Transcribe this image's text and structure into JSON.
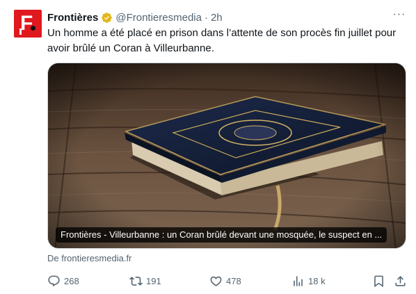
{
  "account": {
    "display_name": "Frontières",
    "handle": "@Frontieresmedia",
    "separator": "·",
    "time": "2h",
    "avatar_letter": "F",
    "avatar_color": "#e0191f",
    "verified_color": "#e2b719"
  },
  "menu": {
    "more_label": "···"
  },
  "tweet": {
    "text": "Un homme a été placé en prison dans l’attente de son procès fin juillet pour avoir brûlé un Coran à Villeurbanne."
  },
  "card": {
    "title": "Frontières - Villeurbanne : un Coran brûlé devant une mosquée, le suspect en ...",
    "source": "De frontieresmedia.fr",
    "image_subject": "book-on-wooden-table"
  },
  "actions": {
    "replies": "268",
    "reposts": "191",
    "likes": "478",
    "views": "18 k",
    "icons": [
      "reply-icon",
      "repost-icon",
      "like-icon",
      "views-icon",
      "bookmark-icon",
      "share-icon"
    ]
  },
  "colors": {
    "text": "#0f1419",
    "secondary": "#536471",
    "border": "#cfd9de"
  }
}
